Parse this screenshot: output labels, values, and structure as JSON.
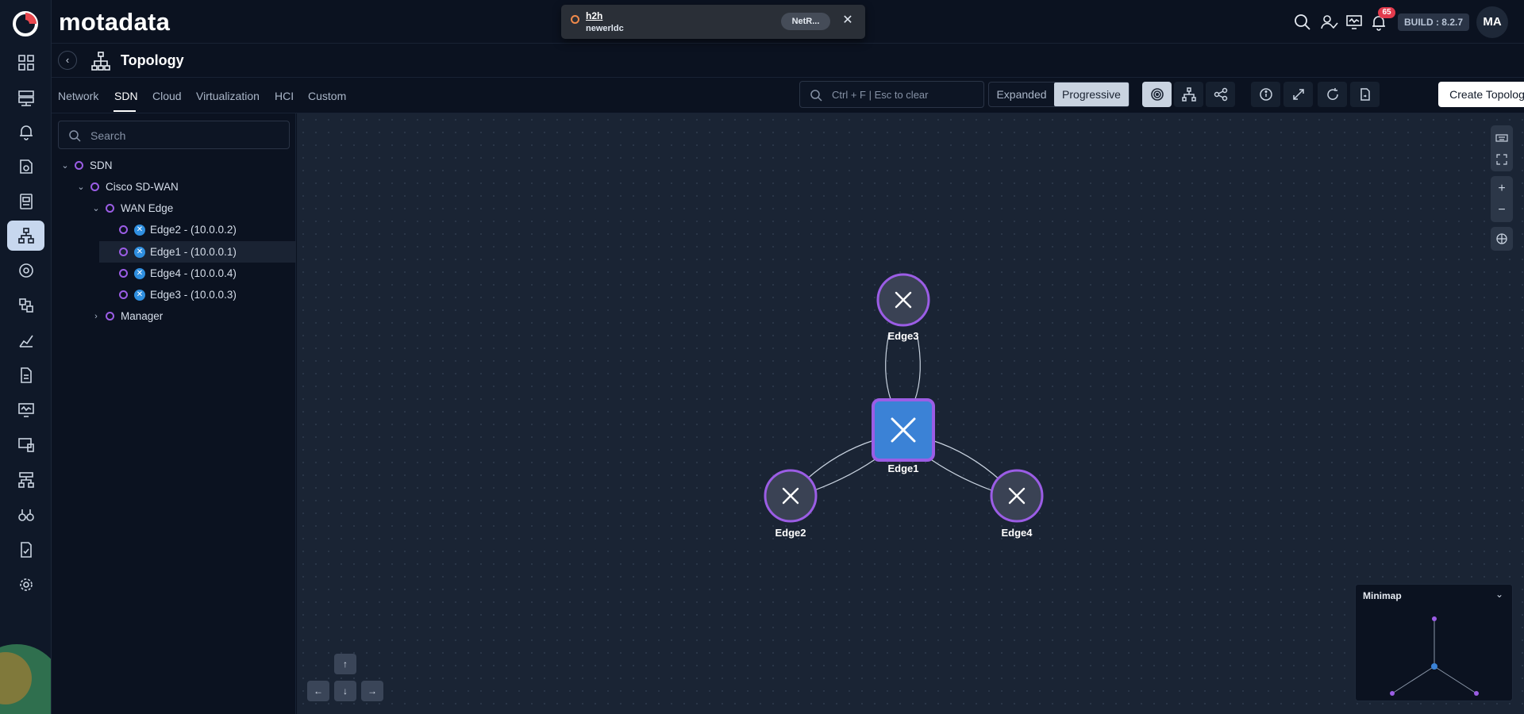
{
  "app": {
    "brand": "motadata",
    "build": "BUILD : 8.2.7",
    "avatar": "MA",
    "alert_count": "65"
  },
  "notification": {
    "title": "h2h",
    "subtitle": "newerldc",
    "pill": "NetR...",
    "close": "✕"
  },
  "page": {
    "title": "Topology",
    "back": "‹"
  },
  "tabs": [
    {
      "label": "Network"
    },
    {
      "label": "SDN"
    },
    {
      "label": "Cloud"
    },
    {
      "label": "Virtualization"
    },
    {
      "label": "HCI"
    },
    {
      "label": "Custom"
    }
  ],
  "toolbar": {
    "search_placeholder": "Ctrl + F | Esc to clear",
    "view_expanded": "Expanded",
    "view_progressive": "Progressive",
    "create_label": "Create Topology View"
  },
  "tree": {
    "search_placeholder": "Search",
    "items": [
      {
        "label": "SDN",
        "chevron": "⌄"
      },
      {
        "label": "Cisco SD-WAN",
        "chevron": "⌄"
      },
      {
        "label": "WAN Edge",
        "chevron": "⌄"
      },
      {
        "label": "Edge2 - (10.0.0.2)"
      },
      {
        "label": "Edge1 - (10.0.0.1)"
      },
      {
        "label": "Edge4 - (10.0.0.4)"
      },
      {
        "label": "Edge3 - (10.0.0.3)"
      },
      {
        "label": "Manager",
        "chevron": "›"
      }
    ]
  },
  "graph": {
    "nodes": [
      {
        "label": "Edge3"
      },
      {
        "label": "Edge1"
      },
      {
        "label": "Edge2"
      },
      {
        "label": "Edge4"
      }
    ]
  },
  "canvas_controls": {
    "zoom_in": "+",
    "zoom_out": "−",
    "up": "↑",
    "left": "←",
    "down": "↓",
    "right": "→"
  },
  "minimap": {
    "title": "Minimap",
    "chevron": "⌄"
  },
  "colors": {
    "accent_purple": "#9b5de5",
    "node_fill": "#3a4254",
    "center_node_fill": "#3b82d6",
    "badge_red": "#e23b4d"
  }
}
